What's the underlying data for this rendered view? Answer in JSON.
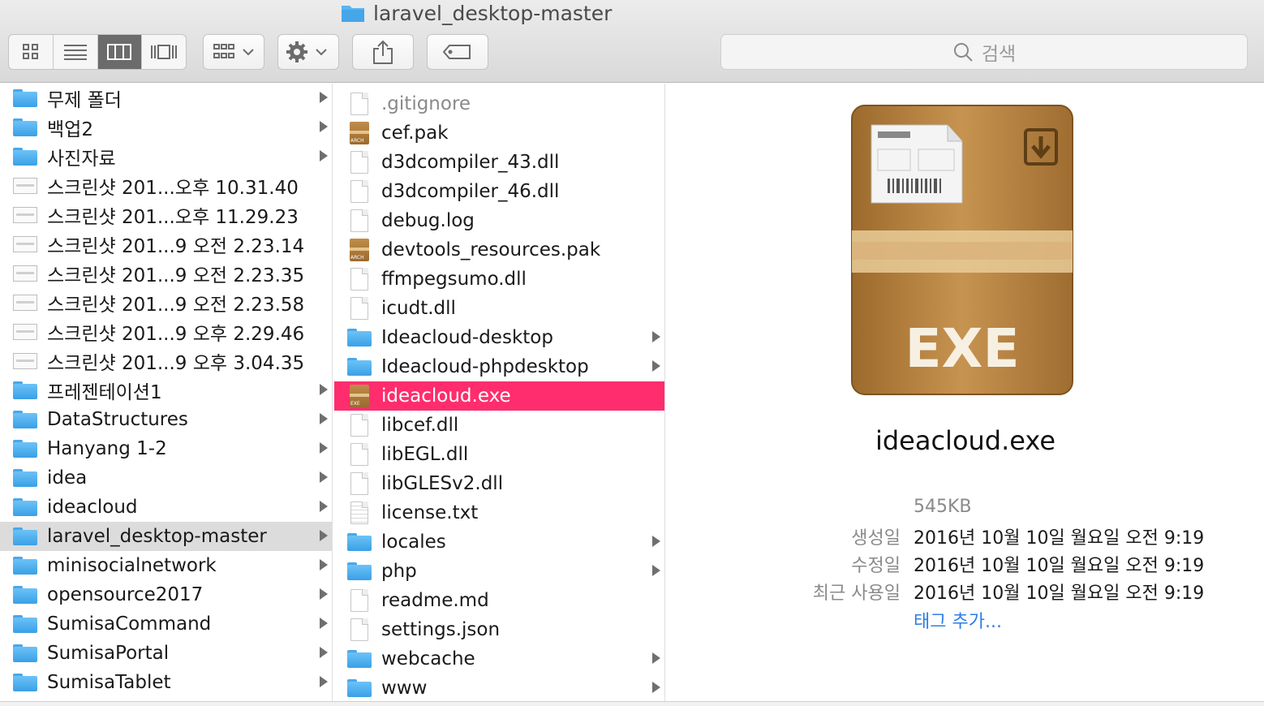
{
  "window": {
    "title": "laravel_desktop-master",
    "search_placeholder": "검색",
    "icons": [
      "view-icons-icon",
      "view-list-icon",
      "view-columns-icon",
      "view-coverflow-icon",
      "group-icon",
      "gear-icon",
      "share-icon",
      "tag-icon",
      "search-icon"
    ]
  },
  "column1": [
    {
      "label": "무제 폴더",
      "kind": "folder",
      "arrow": true
    },
    {
      "label": "백업2",
      "kind": "folder",
      "arrow": true
    },
    {
      "label": "사진자료",
      "kind": "folder",
      "arrow": true
    },
    {
      "label": "스크린샷 201...오후 10.31.40",
      "kind": "shot",
      "arrow": false
    },
    {
      "label": "스크린샷 201...오후 11.29.23",
      "kind": "shot",
      "arrow": false
    },
    {
      "label": "스크린샷 201...9 오전 2.23.14",
      "kind": "shot",
      "arrow": false
    },
    {
      "label": "스크린샷 201...9 오전 2.23.35",
      "kind": "shot",
      "arrow": false
    },
    {
      "label": "스크린샷 201...9 오전 2.23.58",
      "kind": "shot",
      "arrow": false
    },
    {
      "label": "스크린샷 201...9 오후 2.29.46",
      "kind": "shot",
      "arrow": false
    },
    {
      "label": "스크린샷 201...9 오후 3.04.35",
      "kind": "shot",
      "arrow": false
    },
    {
      "label": "프레젠테이션1",
      "kind": "folder",
      "arrow": true
    },
    {
      "label": "DataStructures",
      "kind": "folder",
      "arrow": true
    },
    {
      "label": "Hanyang 1-2",
      "kind": "folder",
      "arrow": true
    },
    {
      "label": "idea",
      "kind": "folder",
      "arrow": true
    },
    {
      "label": "ideacloud",
      "kind": "folder",
      "arrow": true
    },
    {
      "label": "laravel_desktop-master",
      "kind": "folder",
      "arrow": true,
      "selected": "gray"
    },
    {
      "label": "minisocialnetwork",
      "kind": "folder",
      "arrow": true
    },
    {
      "label": "opensource2017",
      "kind": "folder",
      "arrow": true
    },
    {
      "label": "SumisaCommand",
      "kind": "folder",
      "arrow": true
    },
    {
      "label": "SumisaPortal",
      "kind": "folder",
      "arrow": true
    },
    {
      "label": "SumisaTablet",
      "kind": "folder",
      "arrow": true
    }
  ],
  "column2": [
    {
      "label": ".gitignore",
      "kind": "doc",
      "arrow": false,
      "dim": true
    },
    {
      "label": "cef.pak",
      "kind": "arch",
      "arrow": false
    },
    {
      "label": "d3dcompiler_43.dll",
      "kind": "doc",
      "arrow": false
    },
    {
      "label": "d3dcompiler_46.dll",
      "kind": "doc",
      "arrow": false
    },
    {
      "label": "debug.log",
      "kind": "doc",
      "arrow": false
    },
    {
      "label": "devtools_resources.pak",
      "kind": "arch",
      "arrow": false
    },
    {
      "label": "ffmpegsumo.dll",
      "kind": "doc",
      "arrow": false
    },
    {
      "label": "icudt.dll",
      "kind": "doc",
      "arrow": false
    },
    {
      "label": "Ideacloud-desktop",
      "kind": "folder",
      "arrow": true
    },
    {
      "label": "Ideacloud-phpdesktop",
      "kind": "folder",
      "arrow": true
    },
    {
      "label": "ideacloud.exe",
      "kind": "exe",
      "arrow": false,
      "selected": "pink"
    },
    {
      "label": "libcef.dll",
      "kind": "doc",
      "arrow": false
    },
    {
      "label": "libEGL.dll",
      "kind": "doc",
      "arrow": false
    },
    {
      "label": "libGLESv2.dll",
      "kind": "doc",
      "arrow": false
    },
    {
      "label": "license.txt",
      "kind": "doclines",
      "arrow": false
    },
    {
      "label": "locales",
      "kind": "folder",
      "arrow": true
    },
    {
      "label": "php",
      "kind": "folder",
      "arrow": true
    },
    {
      "label": "readme.md",
      "kind": "doc",
      "arrow": false
    },
    {
      "label": "settings.json",
      "kind": "doc",
      "arrow": false
    },
    {
      "label": "webcache",
      "kind": "folder",
      "arrow": true
    },
    {
      "label": "www",
      "kind": "folder",
      "arrow": true
    }
  ],
  "preview": {
    "icon_text": "EXE",
    "filename": "ideacloud.exe",
    "size": "545KB",
    "created_label": "생성일",
    "created_value": "2016년 10월 10일 월요일 오전 9:19",
    "modified_label": "수정일",
    "modified_value": "2016년 10월 10일 월요일 오전 9:19",
    "last_opened_label": "최근 사용일",
    "last_opened_value": "2016년 10월 10일 월요일 오전 9:19",
    "add_tag": "태그 추가..."
  }
}
